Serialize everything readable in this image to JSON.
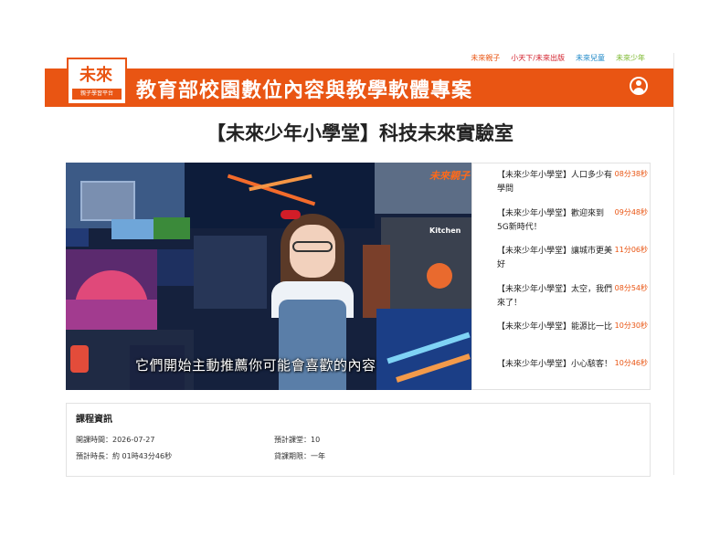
{
  "top_links": [
    {
      "label": "未來親子",
      "color": "#e95513"
    },
    {
      "label": "小天下/未來出版",
      "color": "#d21d28"
    },
    {
      "label": "未來兒童",
      "color": "#1e88c8"
    },
    {
      "label": "未來少年",
      "color": "#7cb82f"
    }
  ],
  "header": {
    "logo_mark": "未來",
    "logo_tag": "親子學習平台",
    "title": "教育部校園數位內容與教學軟體專案",
    "bg_color": "#e95513"
  },
  "course": {
    "title": "【未來少年小學堂】科技未來實驗室"
  },
  "player": {
    "subtitle": "它們開始主動推薦你可能會喜歡的內容",
    "brand": "未來親子",
    "kitchen_label": "Kitchen"
  },
  "playlist": [
    {
      "title": "【未來少年小學堂】人口多少有學問",
      "duration": "08分38秒"
    },
    {
      "title": "【未來少年小學堂】歡迎來到5G新時代！",
      "duration": "09分48秒"
    },
    {
      "title": "【未來少年小學堂】讓城市更美好",
      "duration": "11分06秒"
    },
    {
      "title": "【未來少年小學堂】太空，我們來了！",
      "duration": "08分54秒"
    },
    {
      "title": "【未來少年小學堂】能源比一比",
      "duration": "10分30秒"
    },
    {
      "title": "【未來少年小學堂】小心駭客！",
      "duration": "10分46秒"
    }
  ],
  "info": {
    "heading": "課程資訊",
    "open_date": "開課時間：2026-07-27",
    "lessons": "預計課堂：10",
    "length": "預計時長：約 01時43分46秒",
    "license": "貸課期限：一年"
  }
}
